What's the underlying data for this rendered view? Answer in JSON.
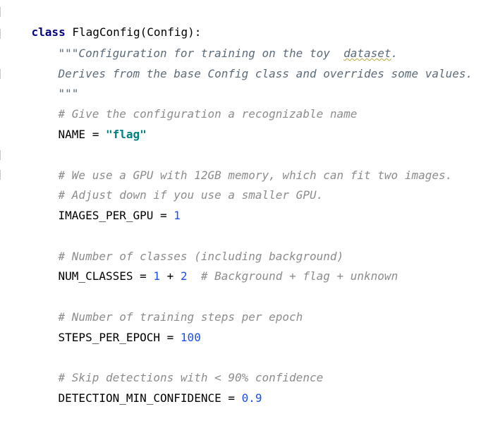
{
  "code": {
    "class_line": {
      "keyword": "class",
      "rest": " FlagConfig(Config):"
    },
    "docstring": {
      "line1_prefix": "\"\"\"Configuration for training on the toy  ",
      "line1_word": "dataset",
      "line1_suffix": ".",
      "line2": "Derives from the base Config class and overrides some values.",
      "line3": "\"\"\""
    },
    "comment_name": "# Give the configuration a recognizable name",
    "name_assign": {
      "lhs": "NAME = ",
      "value": "\"flag\""
    },
    "comment_gpu_1": "# We use a GPU with 12GB memory, which can fit two images.",
    "comment_gpu_2": "# Adjust down if you use a smaller GPU.",
    "images_per_gpu": {
      "lhs": "IMAGES_PER_GPU = ",
      "value": "1"
    },
    "comment_classes": "# Number of classes (including background)",
    "num_classes": {
      "lhs": "NUM_CLASSES = ",
      "v1": "1",
      "op": " + ",
      "v2": "2",
      "comment": "  # Background + flag + unknown"
    },
    "comment_steps": "# Number of training steps per epoch",
    "steps_per_epoch": {
      "lhs": "STEPS_PER_EPOCH = ",
      "value": "100"
    },
    "comment_detect": "# Skip detections with < 90% confidence",
    "detection_min_conf": {
      "lhs": "DETECTION_MIN_CONFIDENCE = ",
      "value": "0.9"
    }
  },
  "colors": {
    "keyword": "#000080",
    "comment": "#8c8c8c",
    "string": "#008080",
    "number": "#1750eb"
  }
}
